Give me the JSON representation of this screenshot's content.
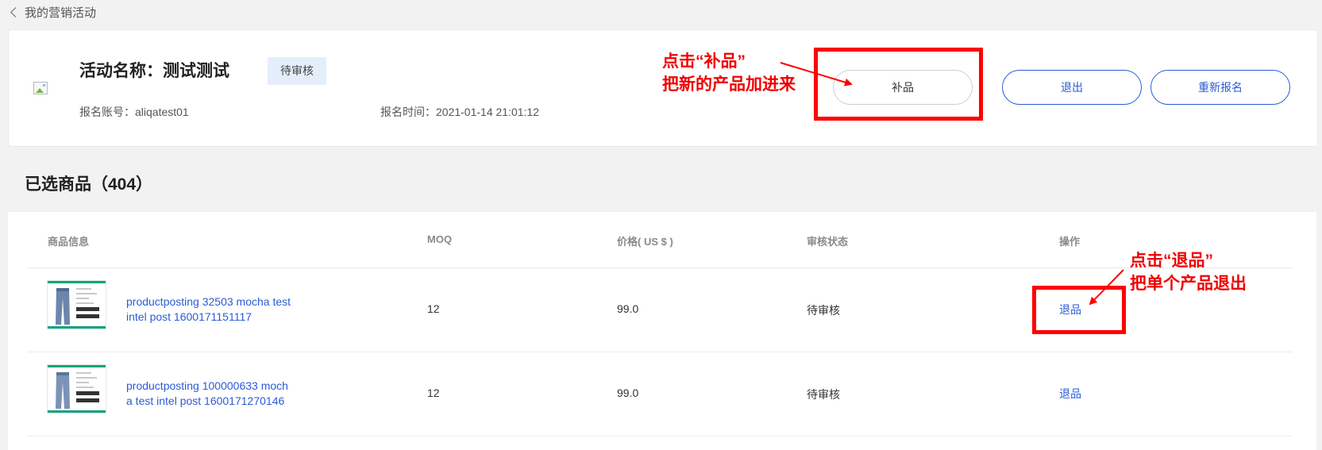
{
  "nav": {
    "back_label": "我的营销活动"
  },
  "activity": {
    "title": "活动名称：测试测试",
    "status": "待审核",
    "account": "报名账号：aliqatest01",
    "time": "报名时间：2021-01-14 21:01:12",
    "buttons": {
      "replenish": "补品",
      "exit": "退出",
      "reapply": "重新报名"
    }
  },
  "selected": {
    "title": "已选商品（404）"
  },
  "table": {
    "headers": {
      "info": "商品信息",
      "moq": "MOQ",
      "price": "价格( US $ )",
      "status": "审核状态",
      "action": "操作"
    },
    "rows": [
      {
        "name_line1": "productposting 32503 mocha test",
        "name_line2": "intel post 1600171151117",
        "moq": "12",
        "price": "99.0",
        "status": "待审核",
        "action": "退品"
      },
      {
        "name_line1": "productposting 100000633 moch",
        "name_line2": "a test intel post 1600171270146",
        "moq": "12",
        "price": "99.0",
        "status": "待审核",
        "action": "退品"
      }
    ]
  },
  "annotations": {
    "replenish_line1": "点击“补品”",
    "replenish_line2": "把新的产品加进来",
    "remove_line1": "点击“退品”",
    "remove_line2": "把单个产品退出"
  },
  "colors": {
    "link": "#2a5bd7",
    "annotation": "#ff0000",
    "badge_bg": "#e4eefb",
    "page_bg": "#f2f2f2"
  }
}
